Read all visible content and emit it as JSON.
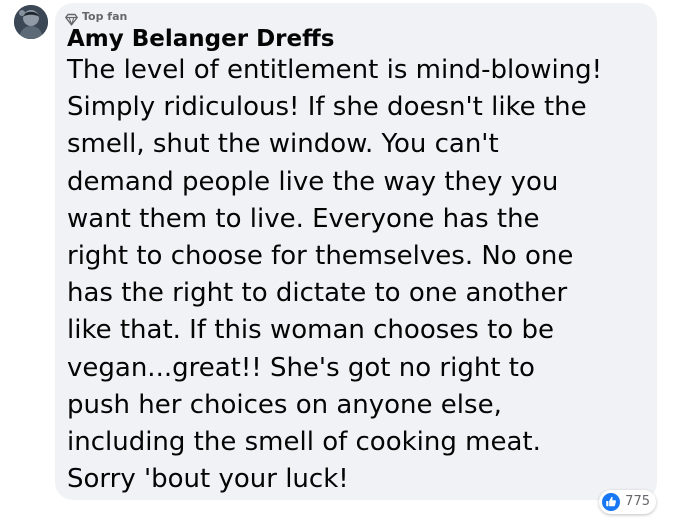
{
  "comment": {
    "badge": {
      "icon": "diamond-icon",
      "label": "Top fan"
    },
    "author": "Amy Belanger Dreffs",
    "text_lines": [
      "The level of entitlement is mind-blowing!",
      "Simply ridiculous! If she doesn't like the",
      "smell, shut the window. You can't",
      "demand people live the way they you",
      "want them to live. Everyone has the",
      "right to choose for themselves. No one",
      "has the right to dictate to one another",
      "like that. If this woman chooses to be",
      "vegan...great!! She's got no right to",
      "push her choices on anyone else,",
      "including the smell of cooking meat.",
      "Sorry 'bout your luck!"
    ],
    "reactions": {
      "icon": "like-icon",
      "count": "775"
    }
  },
  "colors": {
    "bubble_background": "#f0f2f5",
    "text": "#050505",
    "secondary_text": "#65676b",
    "like_blue": "#1877f2"
  }
}
